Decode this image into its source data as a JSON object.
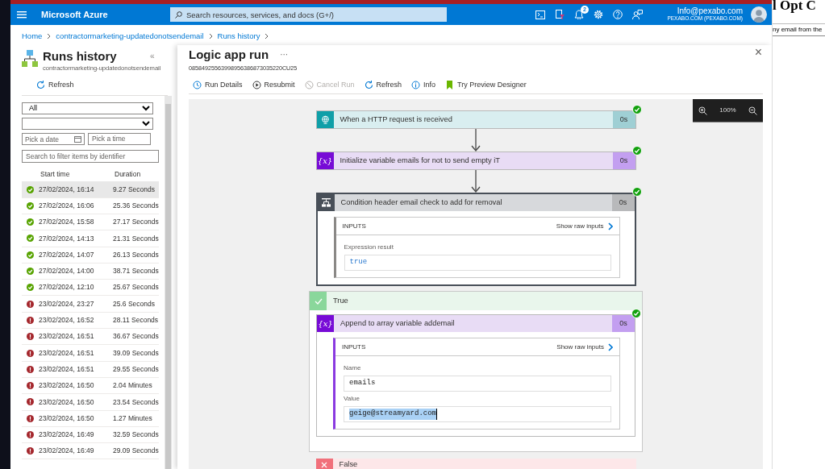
{
  "top_bar": {
    "brand": "Microsoft Azure",
    "search": {
      "placeholder": "Search resources, services, and docs (G+/)"
    },
    "notification_count": "2",
    "account": {
      "email": "Info@pexabo.com",
      "directory": "PEXABO.COM (PEXABO.COM)"
    }
  },
  "breadcrumb": [
    "Home",
    "contractormarketing-updatedonotsendemail",
    "Runs history"
  ],
  "runs_panel": {
    "title": "Runs history",
    "subtitle": "contractormarketing-updatedonotsendemail",
    "collapse": "«",
    "refresh": "Refresh",
    "status_filter": "All",
    "date_placeholder": "Pick a date",
    "time_placeholder": "Pick a time",
    "search_placeholder": "Search to filter items by identifier",
    "columns": [
      "Start time",
      "Duration"
    ],
    "rows": [
      {
        "succeeded": true,
        "start": "27/02/2024, 16:14",
        "duration": "9.27 Seconds",
        "selected": true
      },
      {
        "succeeded": true,
        "start": "27/02/2024, 16:06",
        "duration": "25.36 Seconds",
        "selected": false
      },
      {
        "succeeded": true,
        "start": "27/02/2024, 15:58",
        "duration": "27.17 Seconds",
        "selected": false
      },
      {
        "succeeded": true,
        "start": "27/02/2024, 14:13",
        "duration": "21.31 Seconds",
        "selected": false
      },
      {
        "succeeded": true,
        "start": "27/02/2024, 14:07",
        "duration": "26.13 Seconds",
        "selected": false
      },
      {
        "succeeded": true,
        "start": "27/02/2024, 14:00",
        "duration": "38.71 Seconds",
        "selected": false
      },
      {
        "succeeded": true,
        "start": "27/02/2024, 12:10",
        "duration": "25.67 Seconds",
        "selected": false
      },
      {
        "succeeded": false,
        "start": "23/02/2024, 23:27",
        "duration": "25.6 Seconds",
        "selected": false
      },
      {
        "succeeded": false,
        "start": "23/02/2024, 16:52",
        "duration": "28.11 Seconds",
        "selected": false
      },
      {
        "succeeded": false,
        "start": "23/02/2024, 16:51",
        "duration": "36.67 Seconds",
        "selected": false
      },
      {
        "succeeded": false,
        "start": "23/02/2024, 16:51",
        "duration": "39.09 Seconds",
        "selected": false
      },
      {
        "succeeded": false,
        "start": "23/02/2024, 16:51",
        "duration": "29.55 Seconds",
        "selected": false
      },
      {
        "succeeded": false,
        "start": "23/02/2024, 16:50",
        "duration": "2.04 Minutes",
        "selected": false
      },
      {
        "succeeded": false,
        "start": "23/02/2024, 16:50",
        "duration": "23.54 Seconds",
        "selected": false
      },
      {
        "succeeded": false,
        "start": "23/02/2024, 16:50",
        "duration": "1.27 Minutes",
        "selected": false
      },
      {
        "succeeded": false,
        "start": "23/02/2024, 16:49",
        "duration": "32.59 Seconds",
        "selected": false
      },
      {
        "succeeded": false,
        "start": "23/02/2024, 16:49",
        "duration": "29.09 Seconds",
        "selected": false
      }
    ]
  },
  "run_blade": {
    "title": "Logic app run",
    "more": "···",
    "run_id": "08584925563998956386873035220CU25",
    "close": "×",
    "toolbar": [
      {
        "kind": "details",
        "label": "Run Details",
        "disabled": false
      },
      {
        "kind": "resubmit",
        "label": "Resubmit",
        "disabled": false
      },
      {
        "kind": "cancel",
        "label": "Cancel Run",
        "disabled": true
      },
      {
        "kind": "refresh",
        "label": "Refresh",
        "disabled": false
      },
      {
        "kind": "info",
        "label": "Info",
        "disabled": false
      },
      {
        "kind": "preview",
        "label": "Try Preview Designer",
        "disabled": false
      }
    ],
    "zoom": "100%",
    "steps": [
      {
        "kind": "trigger",
        "title": "When a HTTP request is received",
        "duration": "0s",
        "succeeded": true
      },
      {
        "kind": "variable",
        "icon": "{x}",
        "title": "Initialize variable emails for not to send empty iT",
        "duration": "0s",
        "succeeded": true
      },
      {
        "kind": "condition",
        "title": "Condition header email check to add for removal",
        "duration": "0s",
        "succeeded": true,
        "inputs": {
          "header": "INPUTS",
          "link": "Show raw inputs",
          "fields": [
            {
              "label": "Expression result",
              "value": "true",
              "selected": false
            }
          ]
        }
      }
    ],
    "branches": [
      {
        "kind": "true",
        "label": "True",
        "actions": [
          {
            "kind": "variable",
            "icon": "{x}",
            "title": "Append to array variable addemail",
            "duration": "0s",
            "succeeded": true,
            "inputs": {
              "header": "INPUTS",
              "link": "Show raw inputs",
              "fields": [
                {
                  "label": "Name",
                  "value": "emails",
                  "selected": false
                },
                {
                  "label": "Value",
                  "value": "geige@streamyard.com",
                  "selected": true
                }
              ]
            }
          }
        ]
      },
      {
        "kind": "false",
        "label": "False"
      }
    ]
  },
  "background_window": {
    "heading": "l Opt C",
    "text": "ny email from the"
  }
}
